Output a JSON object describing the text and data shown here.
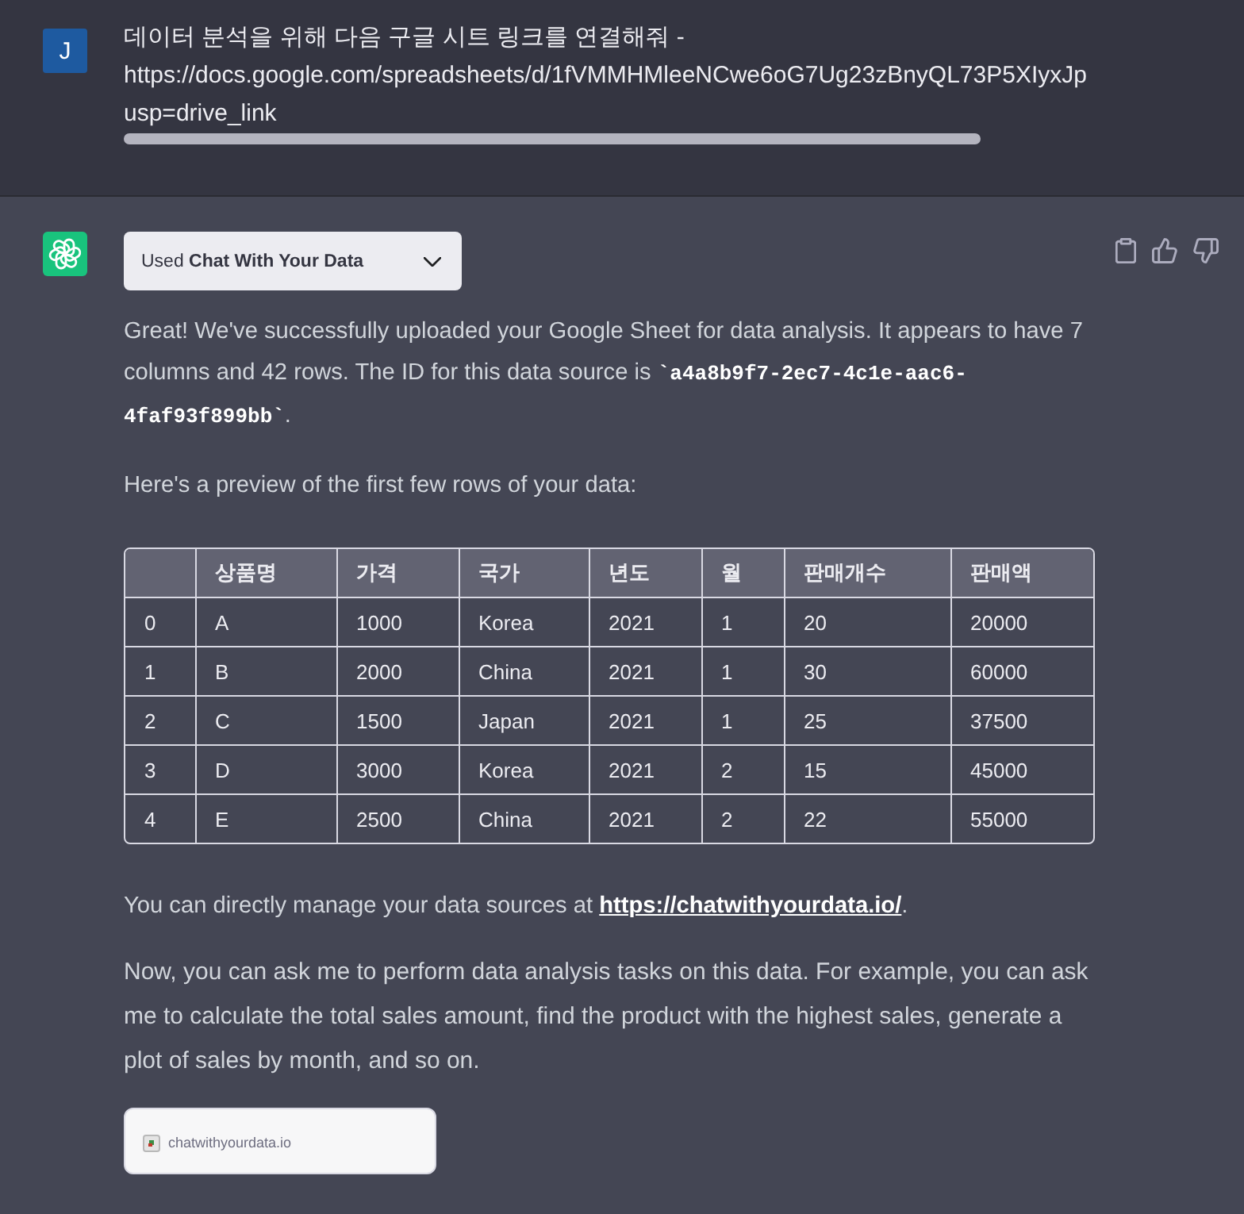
{
  "user_message": {
    "avatar_initial": "J",
    "lines": [
      "데이터 분석을 위해 다음 구글 시트 링크를 연결해줘 -",
      "https://docs.google.com/spreadsheets/d/1fVMMHMleeNCwe6oG7Ug23zBnyQL73P5XIyxJp",
      "usp=drive_link"
    ]
  },
  "assistant_message": {
    "plugin_badge": {
      "text": "Used **Chat With Your Data**",
      "expanded": false
    },
    "paragraphs_before_table": [
      [
        {
          "kind": "text",
          "text": "Great! We've successfully uploaded your Google Sheet for data analysis. It appears to have 7 columns and 42 rows. The ID for this data source is "
        },
        {
          "kind": "code",
          "text": "`a4a8b9f7-2ec7-4c1e-aac6-4faf93f899bb`"
        },
        {
          "kind": "text",
          "text": "."
        }
      ],
      [
        {
          "kind": "text",
          "text": "Here's a preview of the first few rows of your data:"
        }
      ]
    ],
    "table": {
      "columns": [
        "상품명",
        "가격",
        "국가",
        "년도",
        "월",
        "판매개수",
        "판매액"
      ],
      "rows": [
        {
          "index": "0",
          "cells": [
            "A",
            "1000",
            "Korea",
            "2021",
            "1",
            "20",
            "20000"
          ]
        },
        {
          "index": "1",
          "cells": [
            "B",
            "2000",
            "China",
            "2021",
            "1",
            "30",
            "60000"
          ]
        },
        {
          "index": "2",
          "cells": [
            "C",
            "1500",
            "Japan",
            "2021",
            "1",
            "25",
            "37500"
          ]
        },
        {
          "index": "3",
          "cells": [
            "D",
            "3000",
            "Korea",
            "2021",
            "2",
            "15",
            "45000"
          ]
        },
        {
          "index": "4",
          "cells": [
            "E",
            "2500",
            "China",
            "2021",
            "2",
            "22",
            "55000"
          ]
        }
      ]
    },
    "paragraphs_after_table": [
      [
        {
          "kind": "text",
          "text": "You can directly manage your data sources at "
        },
        {
          "kind": "link",
          "text": "https://chatwithyourdata.io/"
        },
        {
          "kind": "text",
          "text": "."
        }
      ],
      [
        {
          "kind": "text",
          "text": "Now, you can ask me to perform data analysis tasks on this data. For example, you can ask me to calculate the total sales amount, find the product with the highest sales, generate a plot of sales by month, and so on."
        }
      ]
    ],
    "link_card": {
      "domain": "chatwithyourdata.io"
    }
  }
}
